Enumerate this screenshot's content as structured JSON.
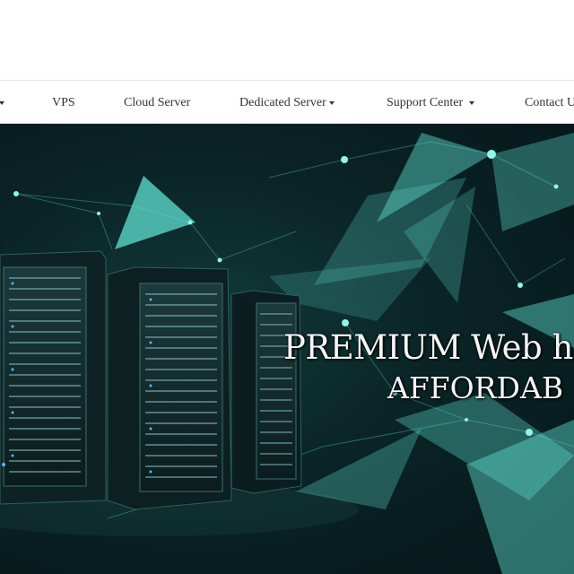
{
  "nav": {
    "items": [
      {
        "label": "",
        "has_caret": true
      },
      {
        "label": "VPS",
        "has_caret": false
      },
      {
        "label": "Cloud Server",
        "has_caret": false
      },
      {
        "label": "Dedicated Server",
        "has_caret": true
      },
      {
        "label": "Support Center",
        "has_caret": true
      },
      {
        "label": "Contact U",
        "has_caret": false
      }
    ]
  },
  "hero": {
    "headline_line1": "PREMIUM Web h",
    "headline_line2": "AFFORDAB",
    "accent_color": "#5fe0d2",
    "background_color": "#0a2426"
  }
}
